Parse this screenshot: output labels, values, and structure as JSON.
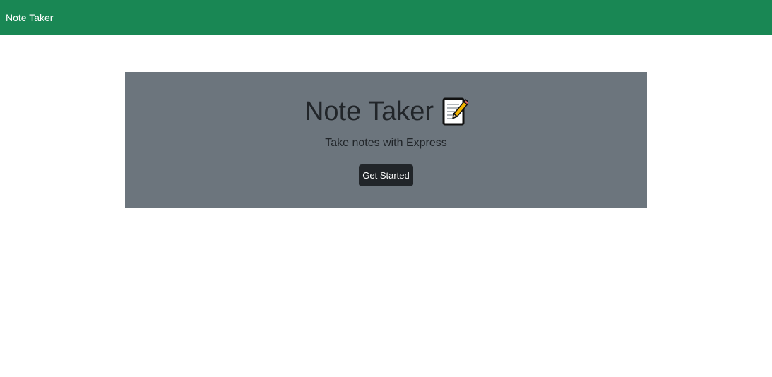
{
  "navbar": {
    "brand": "Note Taker",
    "color": "#198754"
  },
  "hero": {
    "title": "Note Taker",
    "icon": "memo-icon",
    "subtitle": "Take notes with Express",
    "button_label": "Get Started",
    "background": "#6c757d"
  }
}
